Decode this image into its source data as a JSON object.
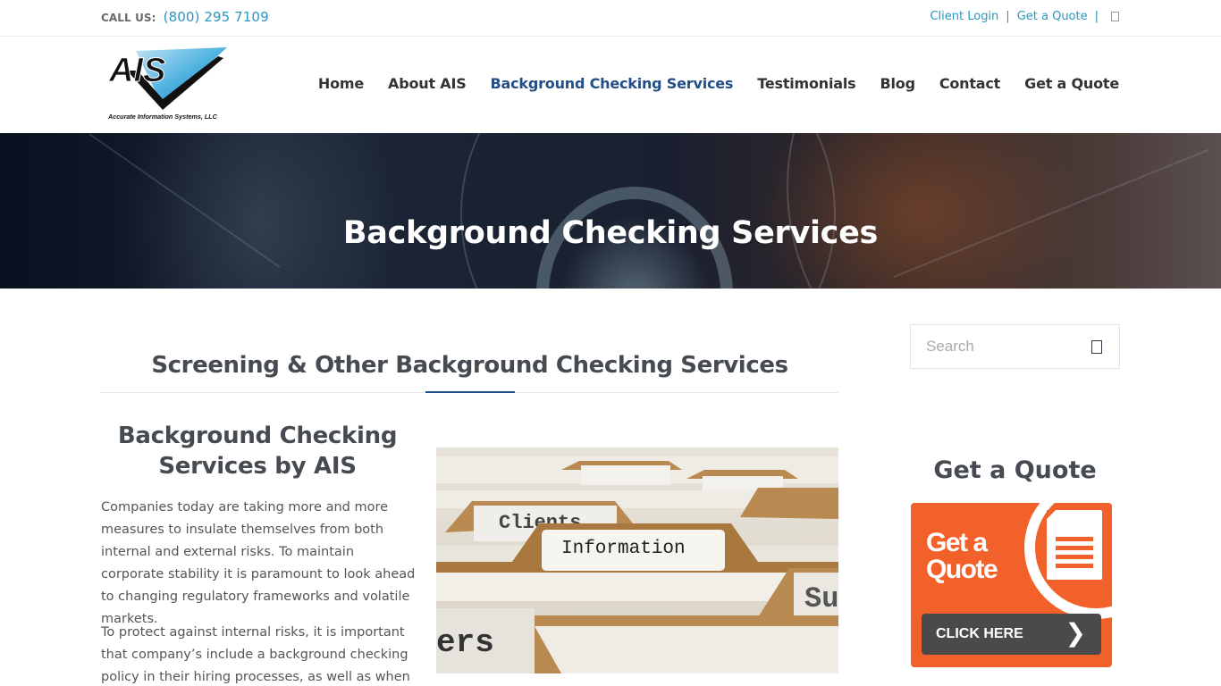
{
  "topbar": {
    "call_label": "CALL US:",
    "phone": "(800) 295 7109",
    "links": [
      "Client Login",
      "Get a Quote"
    ],
    "separator": "|"
  },
  "logo": {
    "text": "AIS",
    "tagline": "Accurate Information Systems, LLC"
  },
  "nav": {
    "items": [
      {
        "label": "Home",
        "active": false
      },
      {
        "label": "About AIS",
        "active": false
      },
      {
        "label": "Background Checking Services",
        "active": true
      },
      {
        "label": "Testimonials",
        "active": false
      },
      {
        "label": "Blog",
        "active": false
      },
      {
        "label": "Contact",
        "active": false
      },
      {
        "label": "Get a Quote",
        "active": false
      }
    ],
    "active_color": "#234e87"
  },
  "hero": {
    "title": "Background Checking Services"
  },
  "main": {
    "section_title": "Screening & Other Background Checking Services",
    "sub_title": "Background Checking Services by AIS",
    "paragraphs": [
      "Companies today are taking more and more measures to insulate themselves from both internal and external risks. To maintain corporate stability it is paramount to look ahead to changing regulatory frameworks and volatile markets.",
      "To protect against internal risks, it is important that company’s include a background checking policy in their hiring processes, as well as when"
    ],
    "photo": {
      "tabs": [
        "Clients",
        "Information",
        "Su",
        "ers"
      ]
    }
  },
  "sidebar": {
    "search_placeholder": "Search",
    "quote_title": "Get a Quote",
    "banner": {
      "line1": "Get a",
      "line2": "Quote",
      "button": "CLICK HERE",
      "arrow": "❯",
      "color": "#f2612a"
    }
  },
  "colors": {
    "link": "#2a96c1",
    "heading": "#464b52"
  }
}
